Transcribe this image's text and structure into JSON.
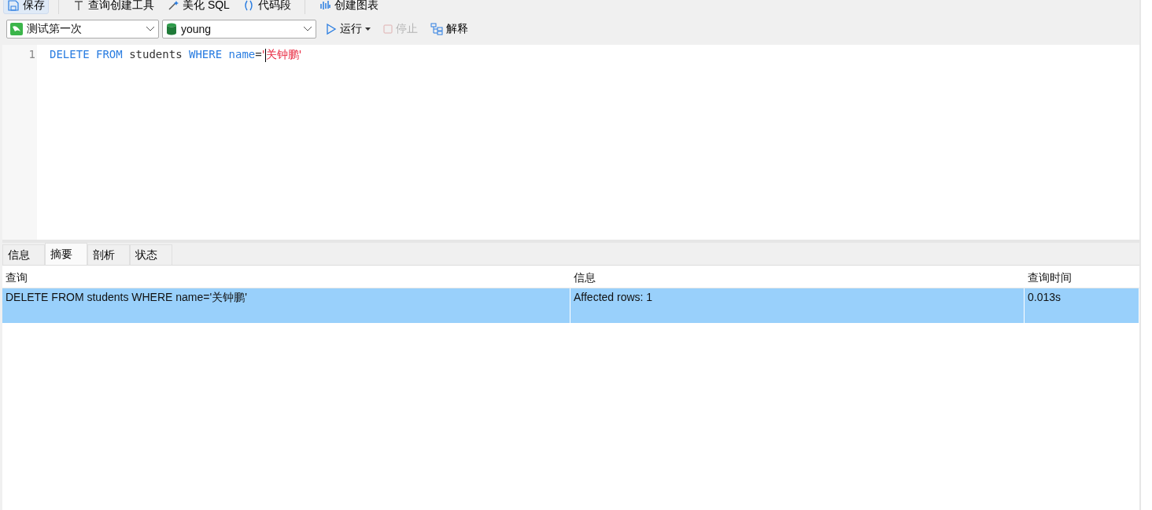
{
  "toolbar": [
    {
      "label": "保存",
      "kind": "save",
      "selected": true
    },
    {
      "label": "查询创建工具",
      "kind": "builder",
      "selected": false
    },
    {
      "label": "美化 SQL",
      "kind": "beautify",
      "selected": false
    },
    {
      "label": "代码段",
      "kind": "snippet",
      "selected": false
    },
    {
      "label": "创建图表",
      "kind": "chart",
      "selected": false
    }
  ],
  "connection": {
    "value": "测试第一次"
  },
  "database": {
    "value": "young"
  },
  "actions": [
    {
      "label": "运行",
      "kind": "run",
      "disabled": false
    },
    {
      "label": "停止",
      "kind": "stop",
      "disabled": true
    },
    {
      "label": "解释",
      "kind": "explain",
      "disabled": false
    }
  ],
  "editor": {
    "lines": [
      {
        "number": "1",
        "tokens": [
          {
            "text": "DELETE FROM",
            "kind": "keyword"
          },
          {
            "text": " students ",
            "kind": "plain"
          },
          {
            "text": "WHERE name",
            "kind": "keyword"
          },
          {
            "text": "=",
            "kind": "plain"
          },
          {
            "text": "'",
            "kind": "string"
          },
          {
            "text": "关钟鹏'",
            "kind": "string"
          }
        ]
      }
    ]
  },
  "result_tabs": [
    {
      "label": "信息",
      "selected": false
    },
    {
      "label": "摘要",
      "selected": true
    },
    {
      "label": "剖析",
      "selected": false
    },
    {
      "label": "状态",
      "selected": false
    }
  ],
  "table": {
    "columns": [
      "查询",
      "信息",
      "查询时间"
    ],
    "rows": [
      {
        "cells": [
          "DELETE FROM students WHERE name='关钟鹏'",
          "Affected rows: 1",
          "0.013s"
        ],
        "selected": true
      }
    ]
  }
}
